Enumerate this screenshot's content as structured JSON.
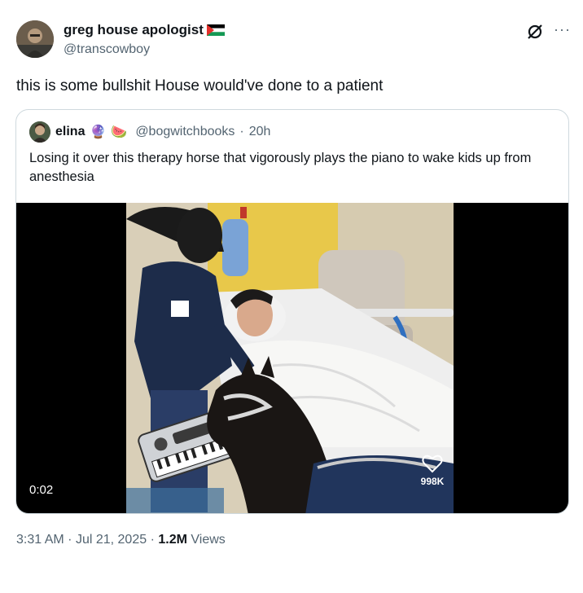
{
  "author": {
    "display_name": "greg house apologist",
    "handle": "@transcowboy",
    "avatar_icon": "author-avatar"
  },
  "header": {
    "grok_icon": "grok-icon",
    "more_label": "···"
  },
  "tweet": {
    "text": "this is some bullshit House would've done to a patient"
  },
  "quote": {
    "display_name": "elina",
    "emoji_1": "🔮",
    "emoji_2": "🍉",
    "handle": "@bogwitchbooks",
    "separator": "·",
    "age": "20h",
    "text": "Losing it over this therapy horse that vigorously plays the piano to wake kids up from anesthesia",
    "video": {
      "elapsed": "0:02",
      "likes": "998K"
    }
  },
  "meta": {
    "time": "3:31 AM",
    "sep1": "·",
    "date": "Jul 21, 2025",
    "sep2": "·",
    "views_count": "1.2M",
    "views_label": "Views"
  },
  "colors": {
    "text_primary": "#0f1419",
    "text_secondary": "#536471",
    "border": "#cfd9de",
    "media_bg": "#000000"
  }
}
